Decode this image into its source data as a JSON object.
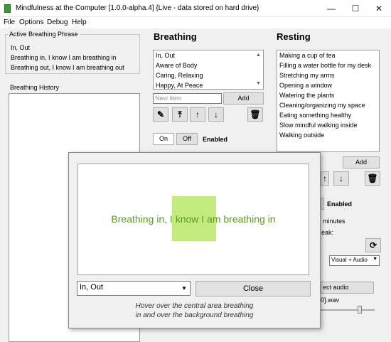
{
  "window": {
    "title": "Mindfulness at the Computer [1.0.0-alpha.4] {Live - data stored on hard drive}",
    "minimize": "—",
    "maximize": "☐",
    "close": "✕"
  },
  "menu": [
    "File",
    "Options",
    "Debug",
    "Help"
  ],
  "active_phrase": {
    "label": "Active Breathing Phrase",
    "lines": [
      "In, Out",
      "Breathing in, I know I am breathing in",
      "Breathing out, I know I am breathing out"
    ]
  },
  "history": {
    "label": "Breathing History"
  },
  "breathing": {
    "heading": "Breathing",
    "items": [
      "In, Out",
      "Aware of Body",
      "Caring, Relaxing",
      "Happy, At Peace"
    ],
    "new_item_placeholder": "New item",
    "add_label": "Add",
    "on_label": "On",
    "off_label": "Off",
    "enabled_label": "Enabled"
  },
  "resting": {
    "heading": "Resting",
    "items": [
      "Making a cup of tea",
      "Filling a water bottle for my desk",
      "Stretching my arms",
      "Opening a window",
      "Watering the plants",
      "Cleaning/organizing my space",
      "Eating something healthy",
      "Slow mindful walking inside",
      "Walking outside"
    ],
    "add_label": "Add",
    "enabled_label": "Enabled",
    "minutes_label": "minutes",
    "break_label": "eak:",
    "notification_type": "Visual + Audio",
    "select_audio_label": "ect audio",
    "audio_file": "0].wav"
  },
  "dialog": {
    "breath_text": "Breathing in, I know I am breathing in",
    "phrase_value": "In, Out",
    "close_label": "Close",
    "hint_line1": "Hover over the central area breathing",
    "hint_line2": "in and over the background breathing"
  },
  "colors": {
    "green_square": "#c3ea7c",
    "breath_text": "#5a9a1f"
  }
}
